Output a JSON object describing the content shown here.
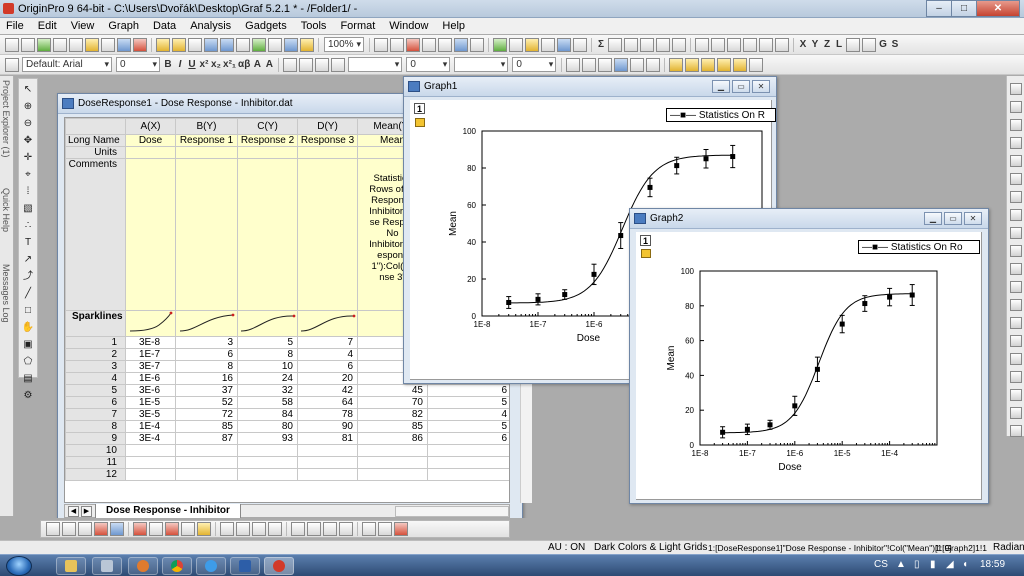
{
  "app": {
    "title": "OriginPro 9 64-bit - C:\\Users\\Dvořák\\Desktop\\Graf 5.2.1 * - /Folder1/ -",
    "window_buttons": [
      "–",
      "□",
      "✕"
    ]
  },
  "menu": [
    "File",
    "Edit",
    "View",
    "Graph",
    "Data",
    "Analysis",
    "Gadgets",
    "Tools",
    "Format",
    "Window",
    "Help"
  ],
  "toolbar": {
    "zoom": "100%",
    "font": "Default: Arial",
    "font_size": "0",
    "line_width": "0",
    "border_width": "0",
    "letters": [
      "X",
      "Y",
      "Z",
      "L",
      "G",
      "S"
    ]
  },
  "left_dock": [
    "Project Explorer (1)",
    "Quick Help",
    "Messages Log"
  ],
  "worksheet": {
    "title": "DoseResponse1 - Dose Response - Inhibitor.dat",
    "columns": [
      "A(X)",
      "B(Y)",
      "C(Y)",
      "D(Y)",
      "Mean(Y)"
    ],
    "row_labels": {
      "long_name": "Long Name",
      "units": "Units",
      "comments": "Comments",
      "sparklines": "Sparklines"
    },
    "long_names": [
      "Dose",
      "Response 1",
      "Response 2",
      "Response 3",
      "Mean"
    ],
    "comment_lines": [
      "Statistics",
      "Rows of [D",
      "Response",
      "Inhibitor.da",
      "se Respon",
      "No",
      "Inhibitor\"!C",
      "espons",
      "1\"):Col(\"R",
      "nse 3\""
    ],
    "rows": [
      {
        "n": "1",
        "a": "3E-8",
        "b": "3",
        "c": "5",
        "d": "7",
        "e": "",
        "f": ""
      },
      {
        "n": "2",
        "a": "1E-7",
        "b": "6",
        "c": "8",
        "d": "4",
        "e": "",
        "f": ""
      },
      {
        "n": "3",
        "a": "3E-7",
        "b": "8",
        "c": "10",
        "d": "6",
        "e": "",
        "f": ""
      },
      {
        "n": "4",
        "a": "1E-6",
        "b": "16",
        "c": "24",
        "d": "20",
        "e": "",
        "f": ""
      },
      {
        "n": "5",
        "a": "3E-6",
        "b": "37",
        "c": "32",
        "d": "42",
        "e": "45",
        "f": "6"
      },
      {
        "n": "6",
        "a": "1E-5",
        "b": "52",
        "c": "58",
        "d": "64",
        "e": "70",
        "f": "5"
      },
      {
        "n": "7",
        "a": "3E-5",
        "b": "72",
        "c": "84",
        "d": "78",
        "e": "82",
        "f": "4"
      },
      {
        "n": "8",
        "a": "1E-4",
        "b": "85",
        "c": "80",
        "d": "90",
        "e": "85",
        "f": "5"
      },
      {
        "n": "9",
        "a": "3E-4",
        "b": "87",
        "c": "93",
        "d": "81",
        "e": "86",
        "f": "6"
      },
      {
        "n": "10",
        "a": "",
        "b": "",
        "c": "",
        "d": "",
        "e": "",
        "f": ""
      },
      {
        "n": "11",
        "a": "",
        "b": "",
        "c": "",
        "d": "",
        "e": "",
        "f": ""
      },
      {
        "n": "12",
        "a": "",
        "b": "",
        "c": "",
        "d": "",
        "e": "",
        "f": ""
      }
    ],
    "sheet_tab": "Dose Response - Inhibitor"
  },
  "graphs": [
    {
      "title": "Graph1",
      "layer": "1",
      "legend": "Statistics On R",
      "chart_data": {
        "type": "scatter",
        "x_scale": "log",
        "xlabel": "Dose",
        "ylabel": "Mean",
        "xlim": [
          1e-08,
          0.001
        ],
        "ylim": [
          0,
          100
        ],
        "xticks": [
          "1E-8",
          "1E-7",
          "1E-6"
        ],
        "yticks": [
          "0",
          "20",
          "40",
          "60",
          "80",
          "100"
        ],
        "x": [
          3e-08,
          1e-07,
          3e-07,
          1e-06,
          3e-06,
          1e-05,
          3e-05,
          0.0001,
          0.0003
        ],
        "y": [
          7.3,
          9.0,
          11.6,
          22.5,
          43.5,
          69.5,
          81.3,
          85.0,
          86.2
        ],
        "yerr": [
          3.2,
          3.0,
          2.6,
          5.5,
          7.0,
          5.0,
          4.5,
          5.0,
          6.0
        ],
        "fit_curve": true,
        "legend_position": "top-right"
      }
    },
    {
      "title": "Graph2",
      "layer": "1",
      "legend": "Statistics On Ro",
      "chart_data": {
        "type": "scatter",
        "x_scale": "log",
        "xlabel": "Dose",
        "ylabel": "Mean",
        "xlim": [
          1e-08,
          0.001
        ],
        "ylim": [
          0,
          100
        ],
        "xticks": [
          "1E-8",
          "1E-7",
          "1E-6",
          "1E-5",
          "1E-4"
        ],
        "yticks": [
          "0",
          "20",
          "40",
          "60",
          "80",
          "100"
        ],
        "x": [
          3e-08,
          1e-07,
          3e-07,
          1e-06,
          3e-06,
          1e-05,
          3e-05,
          0.0001,
          0.0003
        ],
        "y": [
          7.3,
          9.0,
          11.6,
          22.5,
          43.5,
          69.5,
          81.3,
          85.0,
          86.2
        ],
        "yerr": [
          3.2,
          3.0,
          2.6,
          5.5,
          7.0,
          5.0,
          4.5,
          5.0,
          6.0
        ],
        "fit_curve": true,
        "legend_position": "top-right"
      }
    }
  ],
  "statusbar": {
    "au": "AU : ON",
    "theme": "Dark Colors & Light Grids",
    "ref": "1:[DoseResponse1]\"Dose Response - Inhibitor\"!Col(\"Mean\")[1:9]",
    "layer": "1:[Graph2]1!1",
    "angle": "Radian"
  },
  "taskbar": {
    "lang": "CS",
    "time": "18:59"
  },
  "colors": {
    "yellow_header": "#ffffcc",
    "title_blue": "#c9d8ea",
    "sparkline_red": "#cc2222"
  }
}
